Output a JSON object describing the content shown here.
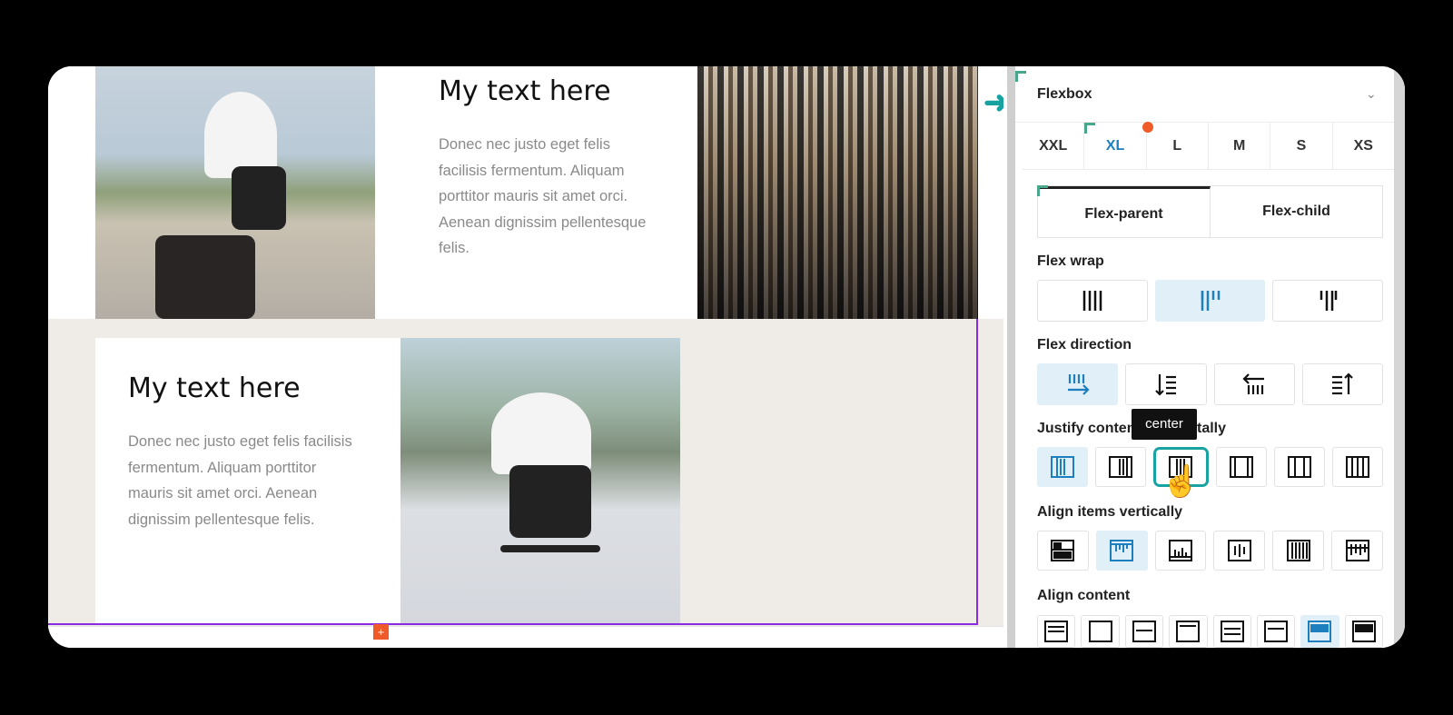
{
  "canvas": {
    "card1": {
      "title": "My text here",
      "body": "Donec nec justo eget felis facilisis fermentum. Aliquam porttitor mauris sit amet orci. Aenean dignissim pellentesque felis."
    },
    "card2": {
      "title": "My text here",
      "body": "Donec nec justo eget felis facilisis fermentum. Aliquam porttitor mauris sit amet orci. Aenean dignissim pellentesque felis."
    },
    "add_button": "+"
  },
  "panel": {
    "title": "Flexbox",
    "breakpoints": [
      "XXL",
      "XL",
      "L",
      "M",
      "S",
      "XS"
    ],
    "active_breakpoint": "XL",
    "tabs": [
      "Flex-parent",
      "Flex-child"
    ],
    "active_tab": "Flex-parent",
    "sections": {
      "flex_wrap": "Flex wrap",
      "flex_direction": "Flex direction",
      "justify_content": "Justify content horizontally",
      "align_items": "Align items vertically",
      "align_content": "Align content"
    },
    "tooltip": "center",
    "accent_color": "#1e7fbf",
    "hover_color": "#18a3a3",
    "brand_orange": "#f05a28"
  }
}
